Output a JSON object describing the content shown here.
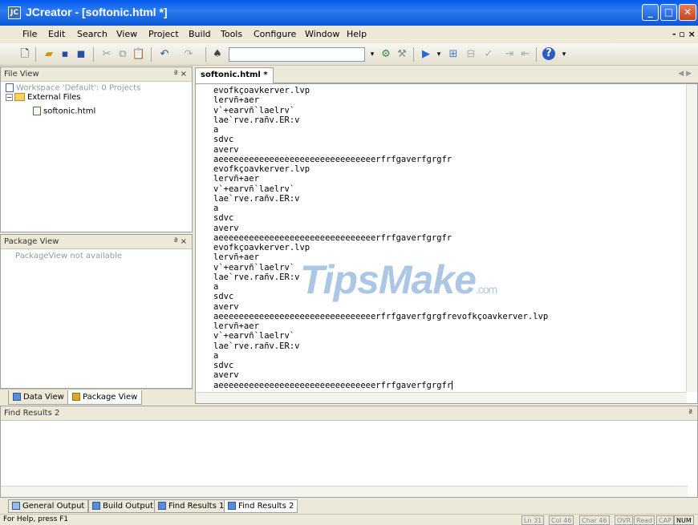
{
  "window": {
    "title": "JCreator - [softonic.html *]",
    "app_icon_text": "JC",
    "controls": {
      "minimize": "_",
      "maximize": "□",
      "close": "✕",
      "mdi_controls": "- ▫ ×"
    }
  },
  "menu": {
    "items": [
      "File",
      "Edit",
      "Search",
      "View",
      "Project",
      "Build",
      "Tools",
      "Configure",
      "Window",
      "Help"
    ]
  },
  "file_view": {
    "title": "File View",
    "close": "ª ×",
    "workspace": "Workspace 'Default': 0 Projects",
    "folder": "External Files",
    "file": "softonic.html"
  },
  "package_view": {
    "title": "Package View",
    "close": "ª ×",
    "message": "PackageView not available"
  },
  "panel_tabs": {
    "data_view": "Data View",
    "package_view": "Package View"
  },
  "editor": {
    "tab": "softonic.html *",
    "lines": [
      "evofkçoavkerver.lvp",
      "lervñ+aer",
      "v`+earvñ`laelrv`",
      "lae`rve.rañv.ER:v",
      "a",
      "sdvc",
      "averv",
      "aeeeeeeeeeeeeeeeeeeeeeeeeeeeeeeerfrfgaverfgrgfr",
      "evofkçoavkerver.lvp",
      "lervñ+aer",
      "v`+earvñ`laelrv`",
      "lae`rve.rañv.ER:v",
      "a",
      "sdvc",
      "averv",
      "aeeeeeeeeeeeeeeeeeeeeeeeeeeeeeeerfrfgaverfgrgfr",
      "evofkçoavkerver.lvp",
      "lervñ+aer",
      "v`+earvñ`laelrv`",
      "lae`rve.rañv.ER:v",
      "a",
      "sdvc",
      "averv",
      "aeeeeeeeeeeeeeeeeeeeeeeeeeeeeeeerfrfgaverfgrgfrevofkçoavkerver.lvp",
      "lervñ+aer",
      "v`+earvñ`laelrv`",
      "lae`rve.rañv.ER:v",
      "a",
      "sdvc",
      "averv",
      "aeeeeeeeeeeeeeeeeeeeeeeeeeeeeeeerfrfgaverfgrgfr"
    ]
  },
  "watermark": {
    "brand": "TipsMake",
    "suffix": ".com"
  },
  "find_results": {
    "title": "Find Results 2"
  },
  "bottom_tabs": [
    "General Output",
    "Build Output",
    "Find Results 1",
    "Find Results 2"
  ],
  "status": {
    "help": "For Help, press F1",
    "fields": [
      "Ln 31",
      "Col 46",
      "Char 46",
      "OVR",
      "Read",
      "CAP",
      "NUM"
    ]
  },
  "colors": {
    "title_bar": "#0058ee",
    "chrome": "#ece9d8",
    "watermark": "#4682c8"
  }
}
